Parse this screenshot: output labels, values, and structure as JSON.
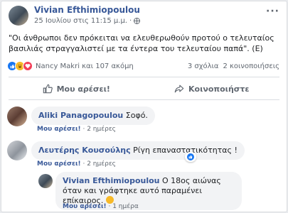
{
  "post": {
    "author": "Vivian Efthimiopoulou",
    "timestamp": "25 Ιουλίου στις 11:15 μ.μ.",
    "privacy_icon": "globe-icon",
    "more_icon": "more-options-icon",
    "text": "\"Οι άνθρωποι δεν πρόκειται να ελευθερωθούν προτού ο τελευταίος βασιλιάς στραγγαλιστεί με τα έντερα του τελευταίου παπά\". (Ε)"
  },
  "reactions": {
    "icons": [
      "like-reaction-icon",
      "haha-reaction-icon",
      "love-reaction-icon"
    ],
    "names": "Nancy Makri και 107 ακόμη",
    "comments_count": "3 σχόλια",
    "shares_count": "2 κοινοποιήσεις"
  },
  "actions": {
    "like_label": "Μου αρέσει!",
    "share_label": "Κοινοποιήστε"
  },
  "comments": [
    {
      "author": "Aliki Panagopoulou",
      "text": "Σοφό.",
      "like_label": "Μου αρέσει!",
      "time": "2 ημέρες"
    },
    {
      "author": "Λευτέρης Κουσούλης",
      "text": "Ρίγη επαναστατικότητας !",
      "like_label": "Μου αρέσει!",
      "time": "2 ημέρες"
    }
  ],
  "reply": {
    "author": "Vivian Efthimiopoulou",
    "text": "Ο 18ος αιώνας όταν και γράφτηκε αυτό παραμένει επίκαιρος.",
    "like_label": "Μου αρέσει!",
    "time": "1 ημέρα"
  },
  "colors": {
    "link_blue": "#385898",
    "like_blue": "#1877f2",
    "love_red": "#f33e58",
    "haha_yellow": "#f7b928"
  }
}
